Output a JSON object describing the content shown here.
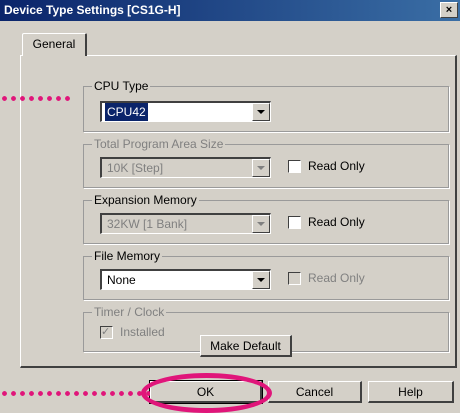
{
  "window": {
    "title": "Device Type Settings [CS1G-H]",
    "close_label": "×"
  },
  "tab": {
    "label": "General"
  },
  "cpu_type": {
    "legend": "CPU Type",
    "value": "CPU42"
  },
  "program_area": {
    "legend": "Total Program Area Size",
    "value": "10K [Step]",
    "read_only_label": "Read Only"
  },
  "expansion_memory": {
    "legend": "Expansion Memory",
    "value": "32KW [1 Bank]",
    "read_only_label": "Read Only"
  },
  "file_memory": {
    "legend": "File Memory",
    "value": "None",
    "read_only_label": "Read Only"
  },
  "timer_clock": {
    "legend": "Timer / Clock",
    "installed_label": "Installed",
    "installed_checked": true
  },
  "buttons": {
    "make_default": "Make Default",
    "ok": "OK",
    "cancel": "Cancel",
    "help": "Help"
  },
  "annotation": {
    "color": "#e0157a"
  }
}
